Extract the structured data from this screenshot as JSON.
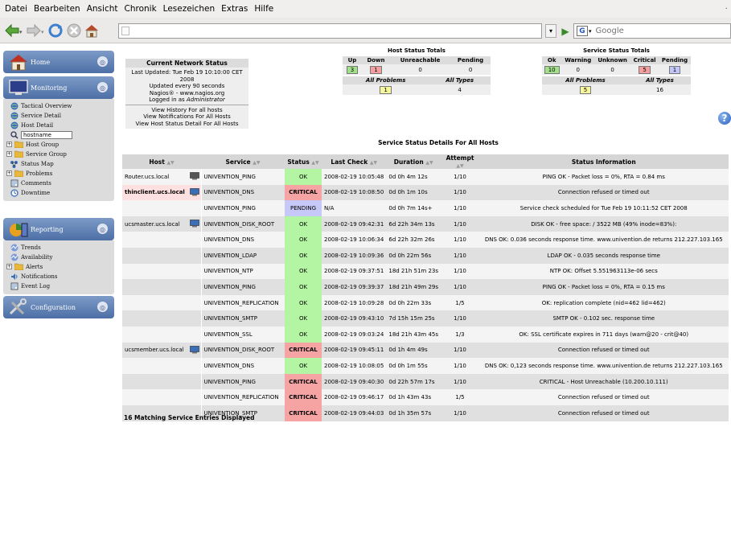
{
  "menu": [
    "Datei",
    "Bearbeiten",
    "Ansicht",
    "Chronik",
    "Lesezeichen",
    "Extras",
    "Hilfe"
  ],
  "search": {
    "placeholder": "Google"
  },
  "sidebar": {
    "home": "Home",
    "monitoring": {
      "title": "Monitoring",
      "items": [
        "Tactical Overview",
        "Service Detail",
        "Host Detail"
      ],
      "search_value": "hostname",
      "items2": [
        "Host Group",
        "Service Group",
        "Status Map",
        "Problems",
        "Comments",
        "Downtime"
      ]
    },
    "reporting": {
      "title": "Reporting",
      "items": [
        "Trends",
        "Availability",
        "Alerts",
        "Notifications",
        "Event Log"
      ]
    },
    "configuration": "Configuration"
  },
  "network_status": {
    "title": "Current Network Status",
    "last_updated": "Last Updated: Tue Feb 19 10:10:00 CET 2008",
    "interval": "Updated every 90 seconds",
    "version": "Nagios® - www.nagios.org",
    "logged_prefix": "Logged in as ",
    "user": "Administrator",
    "link1": "View History For all hosts",
    "link2": "View Notifications For All Hosts",
    "link3": "View Host Status Detail For All Hosts"
  },
  "host_totals": {
    "title": "Host Status Totals",
    "headers": [
      "Up",
      "Down",
      "Unreachable",
      "Pending"
    ],
    "values": [
      "3",
      "1",
      "0",
      "0"
    ],
    "sub_headers": [
      "All Problems",
      "All Types"
    ],
    "sub_values": [
      "1",
      "4"
    ]
  },
  "service_totals": {
    "title": "Service Status Totals",
    "headers": [
      "Ok",
      "Warning",
      "Unknown",
      "Critical",
      "Pending"
    ],
    "values": [
      "10",
      "0",
      "0",
      "5",
      "1"
    ],
    "sub_headers": [
      "All Problems",
      "All Types"
    ],
    "sub_values": [
      "5",
      "16"
    ]
  },
  "details": {
    "title": "Service Status Details For All Hosts",
    "columns": [
      "Host",
      "Service",
      "Status",
      "Last Check",
      "Duration",
      "Attempt",
      "Status Information"
    ],
    "rows": [
      {
        "host": "Router.ucs.local",
        "service": "UNIVENTION_PING",
        "status": "OK",
        "check": "2008-02-19 10:05:48",
        "dur": "0d 0h 4m 12s",
        "att": "1/10",
        "info": "PING OK - Packet loss = 0%, RTA = 0.84 ms"
      },
      {
        "host": "thinclient.ucs.local",
        "service": "UNIVENTION_DNS",
        "status": "CRITICAL",
        "check": "2008-02-19 10:08:50",
        "dur": "0d 0h 1m 10s",
        "att": "1/10",
        "info": "Connection refused or timed out"
      },
      {
        "host": "",
        "service": "UNIVENTION_PING",
        "status": "PENDING",
        "check": "N/A",
        "dur": "0d 0h 7m 14s+",
        "att": "1/10",
        "info": "Service check scheduled for Tue Feb 19 10:11:52 CET 2008"
      },
      {
        "host": "ucsmaster.ucs.local",
        "service": "UNIVENTION_DISK_ROOT",
        "status": "OK",
        "check": "2008-02-19 09:42:31",
        "dur": "6d 22h 34m 13s",
        "att": "1/10",
        "info": "DISK OK - free space: / 3522 MB (49% inode=83%):"
      },
      {
        "host": "",
        "service": "UNIVENTION_DNS",
        "status": "OK",
        "check": "2008-02-19 10:06:34",
        "dur": "6d 22h 32m 26s",
        "att": "1/10",
        "info": "DNS OK: 0.036 seconds response time. www.univention.de returns 212.227.103.165"
      },
      {
        "host": "",
        "service": "UNIVENTION_LDAP",
        "status": "OK",
        "check": "2008-02-19 10:09:36",
        "dur": "0d 0h 22m 56s",
        "att": "1/10",
        "info": "LDAP OK - 0.035 seconds response time"
      },
      {
        "host": "",
        "service": "UNIVENTION_NTP",
        "status": "OK",
        "check": "2008-02-19 09:37:51",
        "dur": "18d 21h 51m 23s",
        "att": "1/10",
        "info": "NTP OK: Offset 5.551963113e-06 secs"
      },
      {
        "host": "",
        "service": "UNIVENTION_PING",
        "status": "OK",
        "check": "2008-02-19 09:39:37",
        "dur": "18d 21h 49m 29s",
        "att": "1/10",
        "info": "PING OK - Packet loss = 0%, RTA = 0.15 ms"
      },
      {
        "host": "",
        "service": "UNIVENTION_REPLICATION",
        "status": "OK",
        "check": "2008-02-19 10:09:28",
        "dur": "0d 0h 22m 33s",
        "att": "1/5",
        "info": "OK: replication complete (nid=462 lid=462)"
      },
      {
        "host": "",
        "service": "UNIVENTION_SMTP",
        "status": "OK",
        "check": "2008-02-19 09:43:10",
        "dur": "7d 15h 15m 25s",
        "att": "1/10",
        "info": "SMTP OK - 0.102 sec. response time"
      },
      {
        "host": "",
        "service": "UNIVENTION_SSL",
        "status": "OK",
        "check": "2008-02-19 09:03:24",
        "dur": "18d 21h 43m 45s",
        "att": "1/3",
        "info": "OK: SSL certificate expires in 711 days (warn@20 - crit@40)"
      },
      {
        "host": "ucsmember.ucs.local",
        "service": "UNIVENTION_DISK_ROOT",
        "status": "CRITICAL",
        "check": "2008-02-19 09:45:11",
        "dur": "0d 1h 4m 49s",
        "att": "1/10",
        "info": "Connection refused or timed out"
      },
      {
        "host": "",
        "service": "UNIVENTION_DNS",
        "status": "OK",
        "check": "2008-02-19 10:08:05",
        "dur": "0d 0h 1m 55s",
        "att": "1/10",
        "info": "DNS OK: 0,123 seconds response time. www.univention.de returns 212.227.103.165"
      },
      {
        "host": "",
        "service": "UNIVENTION_PING",
        "status": "CRITICAL",
        "check": "2008-02-19 09:40:30",
        "dur": "0d 22h 57m 17s",
        "att": "1/10",
        "info": "CRITICAL - Host Unreachable (10.200.10.111)"
      },
      {
        "host": "",
        "service": "UNIVENTION_REPLICATION",
        "status": "CRITICAL",
        "check": "2008-02-19 09:46:17",
        "dur": "0d 1h 43m 43s",
        "att": "1/5",
        "info": "Connection refused or timed out"
      },
      {
        "host": "",
        "service": "UNIVENTION_SMTP",
        "status": "CRITICAL",
        "check": "2008-02-19 09:44:03",
        "dur": "0d 1h 35m 57s",
        "att": "1/10",
        "info": "Connection refused or timed out"
      }
    ],
    "footer": "16 Matching Service Entries Displayed"
  }
}
